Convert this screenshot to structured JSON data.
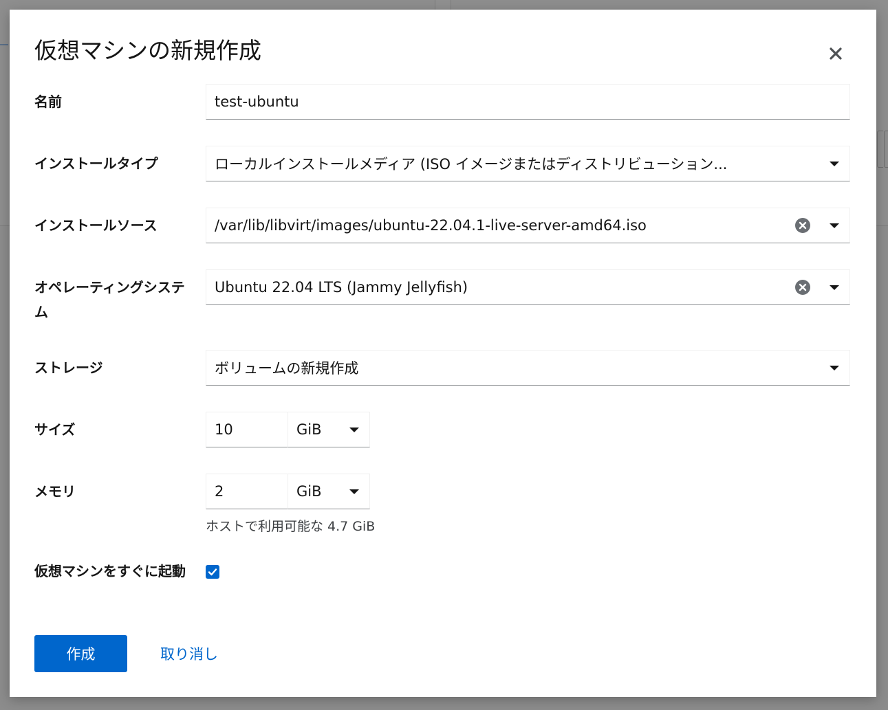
{
  "modal": {
    "title": "仮想マシンの新規作成"
  },
  "fields": {
    "name": {
      "label": "名前",
      "value": "test-ubuntu"
    },
    "install_type": {
      "label": "インストールタイプ",
      "value": "ローカルインストールメディア (ISO イメージまたはディストリビューション..."
    },
    "install_source": {
      "label": "インストールソース",
      "value": "/var/lib/libvirt/images/ubuntu-22.04.1-live-server-amd64.iso"
    },
    "os": {
      "label": "オペレーティングシステム",
      "value": "Ubuntu 22.04 LTS (Jammy Jellyfish)"
    },
    "storage": {
      "label": "ストレージ",
      "value": "ボリュームの新規作成"
    },
    "size": {
      "label": "サイズ",
      "value": "10",
      "unit": "GiB"
    },
    "memory": {
      "label": "メモリ",
      "value": "2",
      "unit": "GiB",
      "helper": "ホストで利用可能な 4.7 GiB"
    },
    "start_vm": {
      "label": "仮想マシンをすぐに起動",
      "checked": true
    }
  },
  "actions": {
    "create_label": "作成",
    "cancel_label": "取り消し"
  },
  "colors": {
    "primary": "#0066cc",
    "backdrop": "#8c8c8c"
  }
}
